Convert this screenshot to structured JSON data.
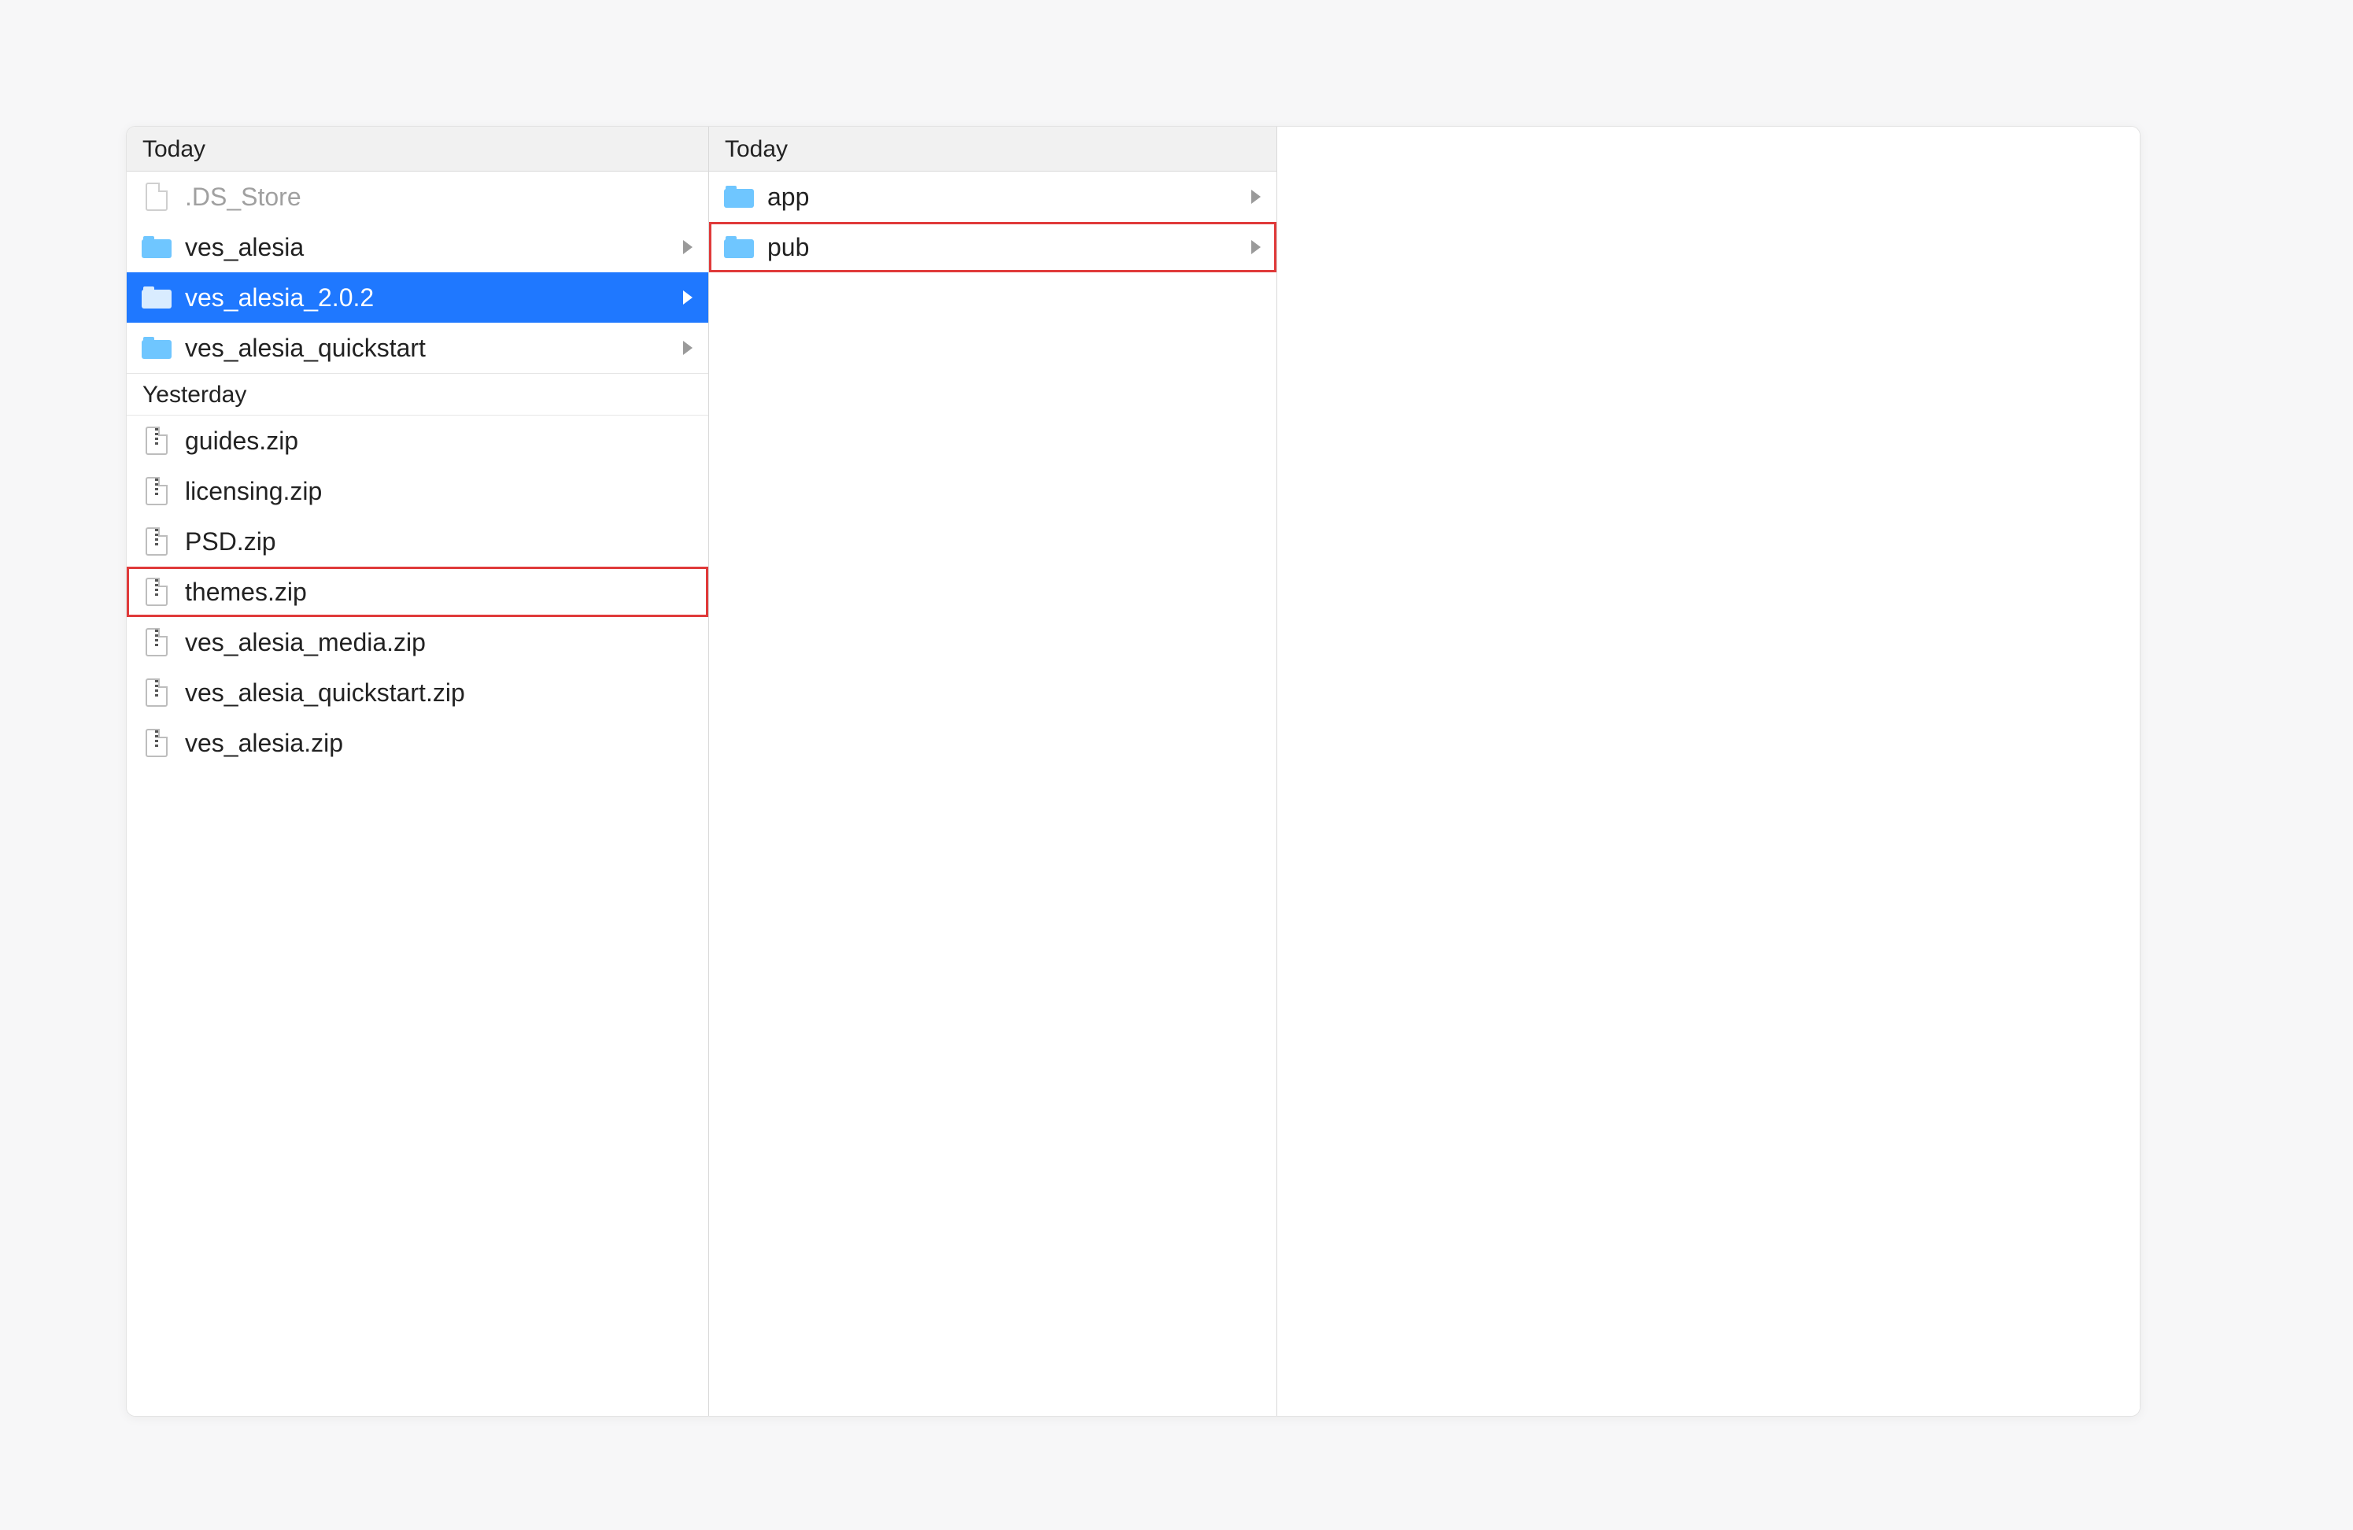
{
  "column1": {
    "header_today": "Today",
    "today_items": [
      {
        "label": ".DS_Store",
        "kind": "doc",
        "dimmed": true,
        "has_children": false,
        "selected": false,
        "highlight": false
      },
      {
        "label": "ves_alesia",
        "kind": "folder",
        "dimmed": false,
        "has_children": true,
        "selected": false,
        "highlight": false
      },
      {
        "label": "ves_alesia_2.0.2",
        "kind": "folder",
        "dimmed": false,
        "has_children": true,
        "selected": true,
        "highlight": false
      },
      {
        "label": "ves_alesia_quickstart",
        "kind": "folder",
        "dimmed": false,
        "has_children": true,
        "selected": false,
        "highlight": false
      }
    ],
    "header_yesterday": "Yesterday",
    "yesterday_items": [
      {
        "label": "guides.zip",
        "kind": "zip",
        "highlight": false
      },
      {
        "label": "licensing.zip",
        "kind": "zip",
        "highlight": false
      },
      {
        "label": "PSD.zip",
        "kind": "zip",
        "highlight": false
      },
      {
        "label": "themes.zip",
        "kind": "zip",
        "highlight": true
      },
      {
        "label": "ves_alesia_media.zip",
        "kind": "zip",
        "highlight": false
      },
      {
        "label": "ves_alesia_quickstart.zip",
        "kind": "zip",
        "highlight": false
      },
      {
        "label": "ves_alesia.zip",
        "kind": "zip",
        "highlight": false
      }
    ]
  },
  "column2": {
    "header_today": "Today",
    "today_items": [
      {
        "label": "app",
        "kind": "folder",
        "has_children": true,
        "highlight": false
      },
      {
        "label": "pub",
        "kind": "folder",
        "has_children": true,
        "highlight": true
      }
    ]
  },
  "colors": {
    "selection": "#1f78ff",
    "highlight_border": "#e03a3a",
    "folder": "#6fc6ff"
  }
}
